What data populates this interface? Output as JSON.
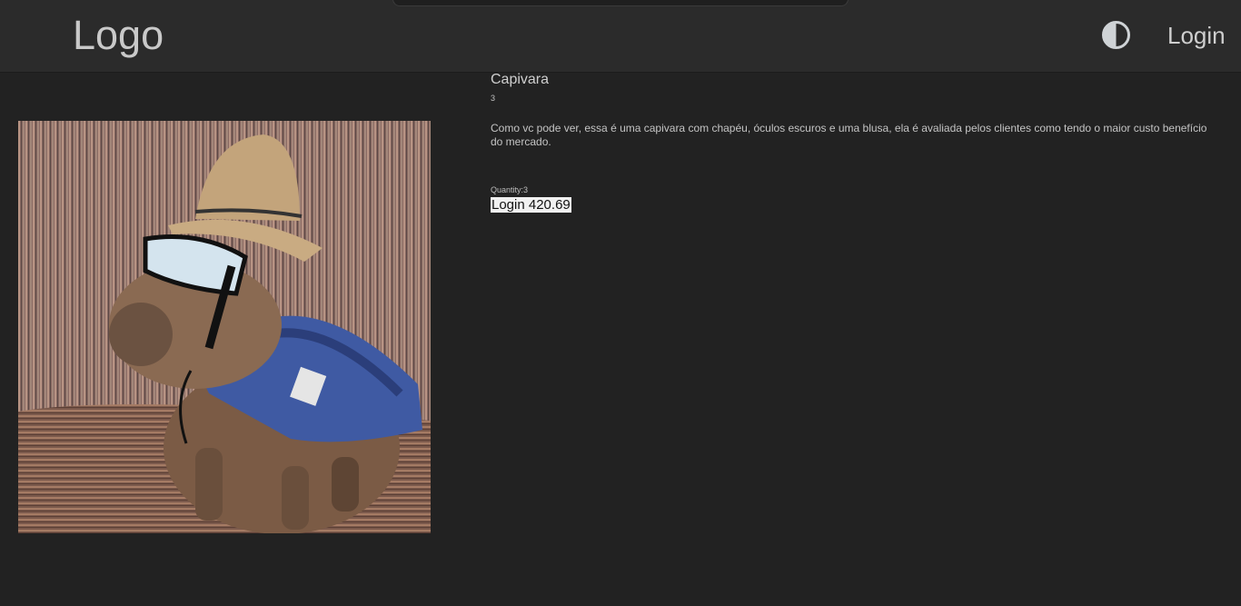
{
  "header": {
    "logo": "Logo",
    "theme_toggle_icon": "half-circle-contrast-icon",
    "login_label": "Login"
  },
  "product": {
    "title": "Capivara",
    "number": "3",
    "description": "Como vc pode ver, essa é uma capivara com chapéu, óculos escuros e uma blusa, ela é avaliada pelos clientes como tendo o maior custo benefício do mercado.",
    "quantity": "Quantity:3",
    "buy_label": "Login 420.69"
  },
  "colors": {
    "page_bg": "#222222",
    "header_bg": "#2b2b2b",
    "text": "#d6d6d6",
    "button_bg": "#f1f1f1"
  }
}
